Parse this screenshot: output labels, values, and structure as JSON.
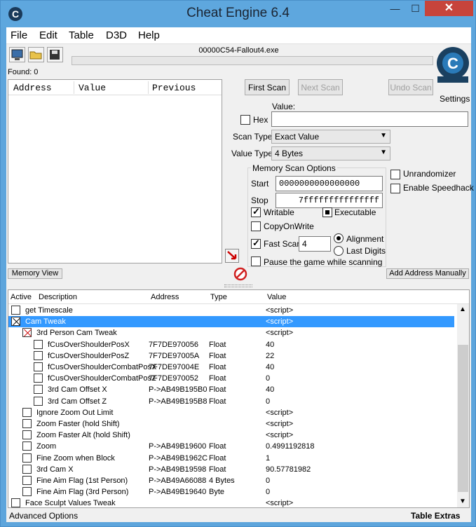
{
  "window": {
    "title": "Cheat Engine 6.4",
    "minimize": "—",
    "maximize": "☐",
    "close": "✕"
  },
  "menu": [
    "File",
    "Edit",
    "Table",
    "D3D",
    "Help"
  ],
  "process_name": "00000C54-Fallout4.exe",
  "found_label": "Found: 0",
  "results_columns": [
    "Address",
    "Value",
    "Previous"
  ],
  "scan": {
    "first_scan": "First Scan",
    "next_scan": "Next Scan",
    "undo_scan": "Undo Scan",
    "settings": "Settings",
    "value_label": "Value:",
    "hex_label": "Hex",
    "scan_type_label": "Scan Type",
    "scan_type_value": "Exact Value",
    "value_type_label": "Value Type",
    "value_type_value": "4 Bytes",
    "memory_scan_options": "Memory Scan Options",
    "start_label": "Start",
    "start_value": "0000000000000000",
    "stop_label": "Stop",
    "stop_value": "7fffffffffffffff",
    "writable": "Writable",
    "executable": "Executable",
    "copy_on_write": "CopyOnWrite",
    "fast_scan": "Fast Scan",
    "fast_scan_value": "4",
    "alignment": "Alignment",
    "last_digits": "Last Digits",
    "pause_game": "Pause the game while scanning",
    "unrandomizer": "Unrandomizer",
    "enable_speedhack": "Enable Speedhack"
  },
  "buttons": {
    "memory_view": "Memory View",
    "add_address_manually": "Add Address Manually"
  },
  "table_columns": [
    "Active",
    "Description",
    "Address",
    "Type",
    "Value"
  ],
  "table_rows": [
    {
      "indent": 0,
      "state": "empty",
      "description": "get Timescale",
      "address": "",
      "type": "",
      "value": "<script>"
    },
    {
      "indent": 0,
      "state": "x",
      "description": "Cam Tweak",
      "address": "",
      "type": "",
      "value": "<script>",
      "selected": true
    },
    {
      "indent": 1,
      "state": "xred",
      "description": "3rd Person Cam Tweak",
      "address": "",
      "type": "",
      "value": "<script>"
    },
    {
      "indent": 2,
      "state": "empty",
      "description": "fCusOverShoulderPosX",
      "address": "7F7DE970056",
      "type": "Float",
      "value": "40"
    },
    {
      "indent": 2,
      "state": "empty",
      "description": "fCusOverShoulderPosZ",
      "address": "7F7DE97005A",
      "type": "Float",
      "value": "22"
    },
    {
      "indent": 2,
      "state": "empty",
      "description": "fCusOverShoulderCombatPosX",
      "address": "7F7DE97004E",
      "type": "Float",
      "value": "40"
    },
    {
      "indent": 2,
      "state": "empty",
      "description": "fCusOverShoulderCombatPosZ",
      "address": "7F7DE970052",
      "type": "Float",
      "value": "0"
    },
    {
      "indent": 2,
      "state": "empty",
      "description": "3rd Cam Offset X",
      "address": "P->AB49B195B0",
      "type": "Float",
      "value": "40"
    },
    {
      "indent": 2,
      "state": "empty",
      "description": "3rd Cam Offset Z",
      "address": "P->AB49B195B8",
      "type": "Float",
      "value": "0"
    },
    {
      "indent": 1,
      "state": "empty",
      "description": "Ignore Zoom Out Limit",
      "address": "",
      "type": "",
      "value": "<script>"
    },
    {
      "indent": 1,
      "state": "empty",
      "description": "Zoom Faster (hold Shift)",
      "address": "",
      "type": "",
      "value": "<script>"
    },
    {
      "indent": 1,
      "state": "empty",
      "description": "Zoom Faster Alt (hold Shift)",
      "address": "",
      "type": "",
      "value": "<script>"
    },
    {
      "indent": 1,
      "state": "empty",
      "description": "Zoom",
      "address": "P->AB49B19600",
      "type": "Float",
      "value": "0.4991192818"
    },
    {
      "indent": 1,
      "state": "empty",
      "description": "Fine Zoom when Block",
      "address": "P->AB49B1962C",
      "type": "Float",
      "value": "1"
    },
    {
      "indent": 1,
      "state": "empty",
      "description": "3rd Cam X",
      "address": "P->AB49B19598",
      "type": "Float",
      "value": "90.57781982"
    },
    {
      "indent": 1,
      "state": "empty",
      "description": "Fine Aim Flag (1st Person)",
      "address": "P->AB49A66088",
      "type": "4 Bytes",
      "value": "0"
    },
    {
      "indent": 1,
      "state": "empty",
      "description": "Fine Aim Flag (3rd Person)",
      "address": "P->AB49B19640",
      "type": "Byte",
      "value": "0"
    },
    {
      "indent": 0,
      "state": "empty",
      "description": "Face Sculpt Values Tweak",
      "address": "",
      "type": "",
      "value": "<script>"
    }
  ],
  "status": {
    "advanced_options": "Advanced Options",
    "table_extras": "Table Extras"
  }
}
